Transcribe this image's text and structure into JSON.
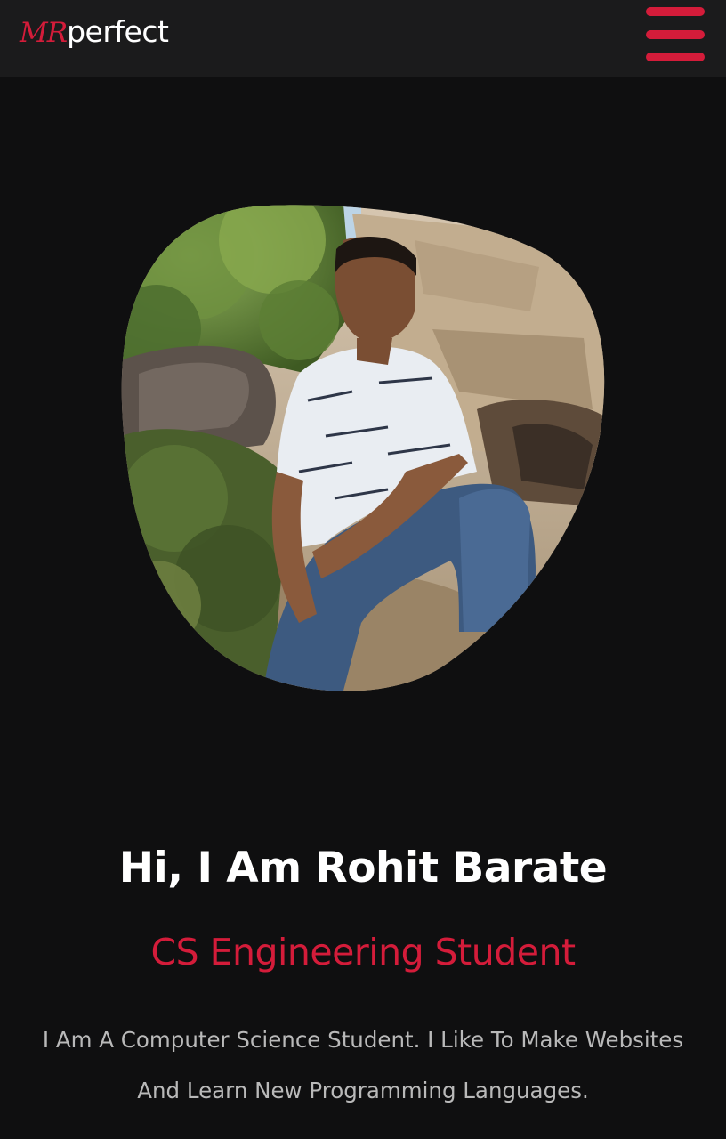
{
  "navbar": {
    "logo_prefix": "MR",
    "logo_suffix": "perfect",
    "menu_icon": "hamburger-menu-icon"
  },
  "hero": {
    "photo_alt": "Rohit Barate",
    "greeting": "Hi, I Am Rohit Barate",
    "role": "CS Engineering Student",
    "description": "I Am A Computer Science Student. I Like To Make Websites And Learn New Programming Languages."
  },
  "colors": {
    "accent": "#d41c3a",
    "background": "#0f0f10",
    "navbar": "#1b1b1c",
    "text": "#ffffff",
    "muted_text": "#b9b9b9"
  }
}
